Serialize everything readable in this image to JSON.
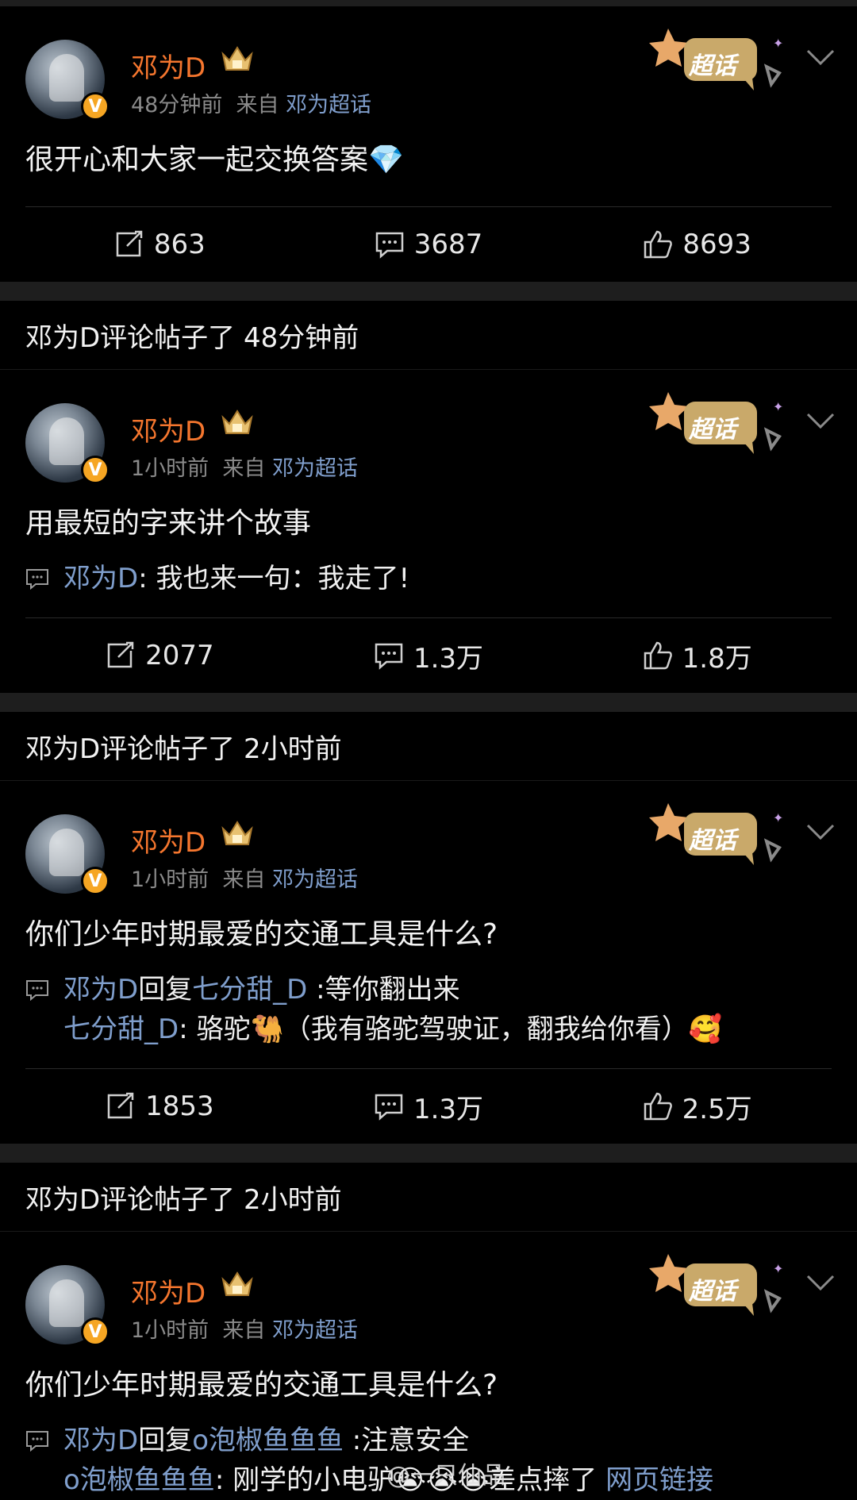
{
  "posts": [
    {
      "header": null,
      "author": "邓为D",
      "time": "48分钟前",
      "source_prefix": "来自",
      "source": "邓为超话",
      "text": "很开心和大家一起交换答案💎",
      "comments": [],
      "reposts": "863",
      "comment_count": "3687",
      "likes": "8693"
    },
    {
      "header": "邓为D评论帖子了 48分钟前",
      "author": "邓为D",
      "time": "1小时前",
      "source_prefix": "来自",
      "source": "邓为超话",
      "text": "用最短的字来讲个故事",
      "comments": [
        {
          "user": "邓为D",
          "reply": "",
          "reply_to": "",
          "text": ": 我也来一句：我走了!"
        }
      ],
      "reposts": "2077",
      "comment_count": "1.3万",
      "likes": "1.8万"
    },
    {
      "header": "邓为D评论帖子了 2小时前",
      "author": "邓为D",
      "time": "1小时前",
      "source_prefix": "来自",
      "source": "邓为超话",
      "text": "你们少年时期最爱的交通工具是什么?",
      "comments": [
        {
          "user": "邓为D",
          "reply": "回复",
          "reply_to": "七分甜_D",
          "text": " :等你翻出来"
        },
        {
          "user": "七分甜_D",
          "reply": "",
          "reply_to": "",
          "text": ": 骆驼🐫（我有骆驼驾驶证，翻我给你看）🥰"
        }
      ],
      "reposts": "1853",
      "comment_count": "1.3万",
      "likes": "2.5万"
    },
    {
      "header": "邓为D评论帖子了 2小时前",
      "author": "邓为D",
      "time": "1小时前",
      "source_prefix": "来自",
      "source": "邓为超话",
      "text": "你们少年时期最爱的交通工具是什么?",
      "comments": [
        {
          "user": "邓为D",
          "reply": "回复",
          "reply_to": "o泡椒鱼鱼鱼",
          "text": " :注意安全"
        },
        {
          "user": "o泡椒鱼鱼鱼",
          "reply": "",
          "reply_to": "",
          "text": ": 刚学的小电驴😭😭😭差点摔了",
          "link": "网页链接"
        }
      ],
      "reposts": "",
      "comment_count": "",
      "likes": ""
    }
  ],
  "chaohua_label": "超话",
  "watermark": "@一只仙品",
  "colors": {
    "username": "#f5762e",
    "link": "#7f9ecc",
    "background": "#000000",
    "separator": "#1e1e1e"
  }
}
